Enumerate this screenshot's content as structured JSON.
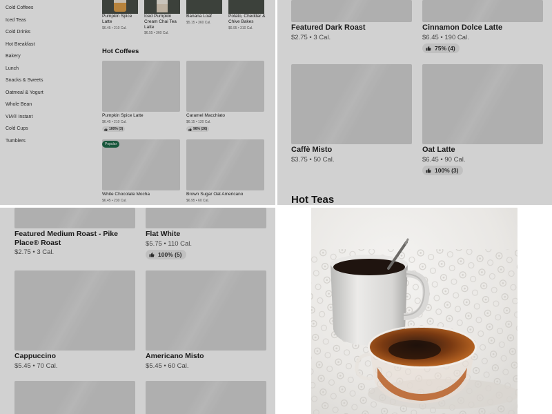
{
  "sidebar": {
    "categories": [
      "Cold Coffees",
      "Iced Teas",
      "Cold Drinks",
      "Hot Breakfast",
      "Bakery",
      "Lunch",
      "Snacks & Sweets",
      "Oatmeal & Yogurt",
      "Whole Bean",
      "VIA® Instant",
      "Cold Cups",
      "Tumblers"
    ]
  },
  "top_strip": [
    {
      "name": "Pumpkin Spice Latte",
      "meta": "$6.45 • 210 Cal."
    },
    {
      "name": "Iced Pumpkin Cream Chai Tea Latte",
      "meta": "$6.55 • 360 Cal."
    },
    {
      "name": "Banana Loaf",
      "meta": "$5.15 • 360 Cal."
    },
    {
      "name": "Potato, Cheddar & Chive Bakes",
      "meta": "$6.95 • 310 Cal."
    }
  ],
  "hot_coffees": {
    "title": "Hot Coffees",
    "items": [
      {
        "name": "Pumpkin Spice Latte",
        "meta": "$6.45 • 210 Cal.",
        "rating": "100% (3)"
      },
      {
        "name": "Caramel Macchiato",
        "meta": "$6.15 • 120 Cal.",
        "rating": "96% (26)"
      },
      {
        "name": "White Chocolate Mocha",
        "meta": "$6.45 • 230 Cal.",
        "badge": "Popular"
      },
      {
        "name": "Brown Sugar Oat Americano",
        "meta": "$6.95 • 60 Cal."
      }
    ]
  },
  "pane2": {
    "items": [
      {
        "name": "Featured Dark Roast",
        "meta": "$2.75 • 3 Cal."
      },
      {
        "name": "Cinnamon Dolce Latte",
        "meta": "$6.45 • 190 Cal.",
        "rating": "75% (4)"
      },
      {
        "name": "Caffè Misto",
        "meta": "$3.75 • 50 Cal."
      },
      {
        "name": "Oat Latte",
        "meta": "$6.45 • 90 Cal.",
        "rating": "100% (3)"
      }
    ],
    "next_section": "Hot Teas"
  },
  "pane3": {
    "items": [
      {
        "name": "Featured Medium Roast - Pike Place® Roast",
        "meta": "$2.75 • 3 Cal."
      },
      {
        "name": "Flat White",
        "meta": "$5.75 • 110 Cal.",
        "rating": "100% (5)"
      },
      {
        "name": "Cappuccino",
        "meta": "$5.45 • 70 Cal."
      },
      {
        "name": "Americano Misto",
        "meta": "$5.45 • 60 Cal."
      }
    ]
  },
  "colors": {
    "popular_badge": "#1e6b4a",
    "placeholder": "#d6d6d6",
    "overlay": "rgba(0,0,0,0.18)"
  },
  "icons": {
    "rating": "thumbs-up-icon"
  }
}
